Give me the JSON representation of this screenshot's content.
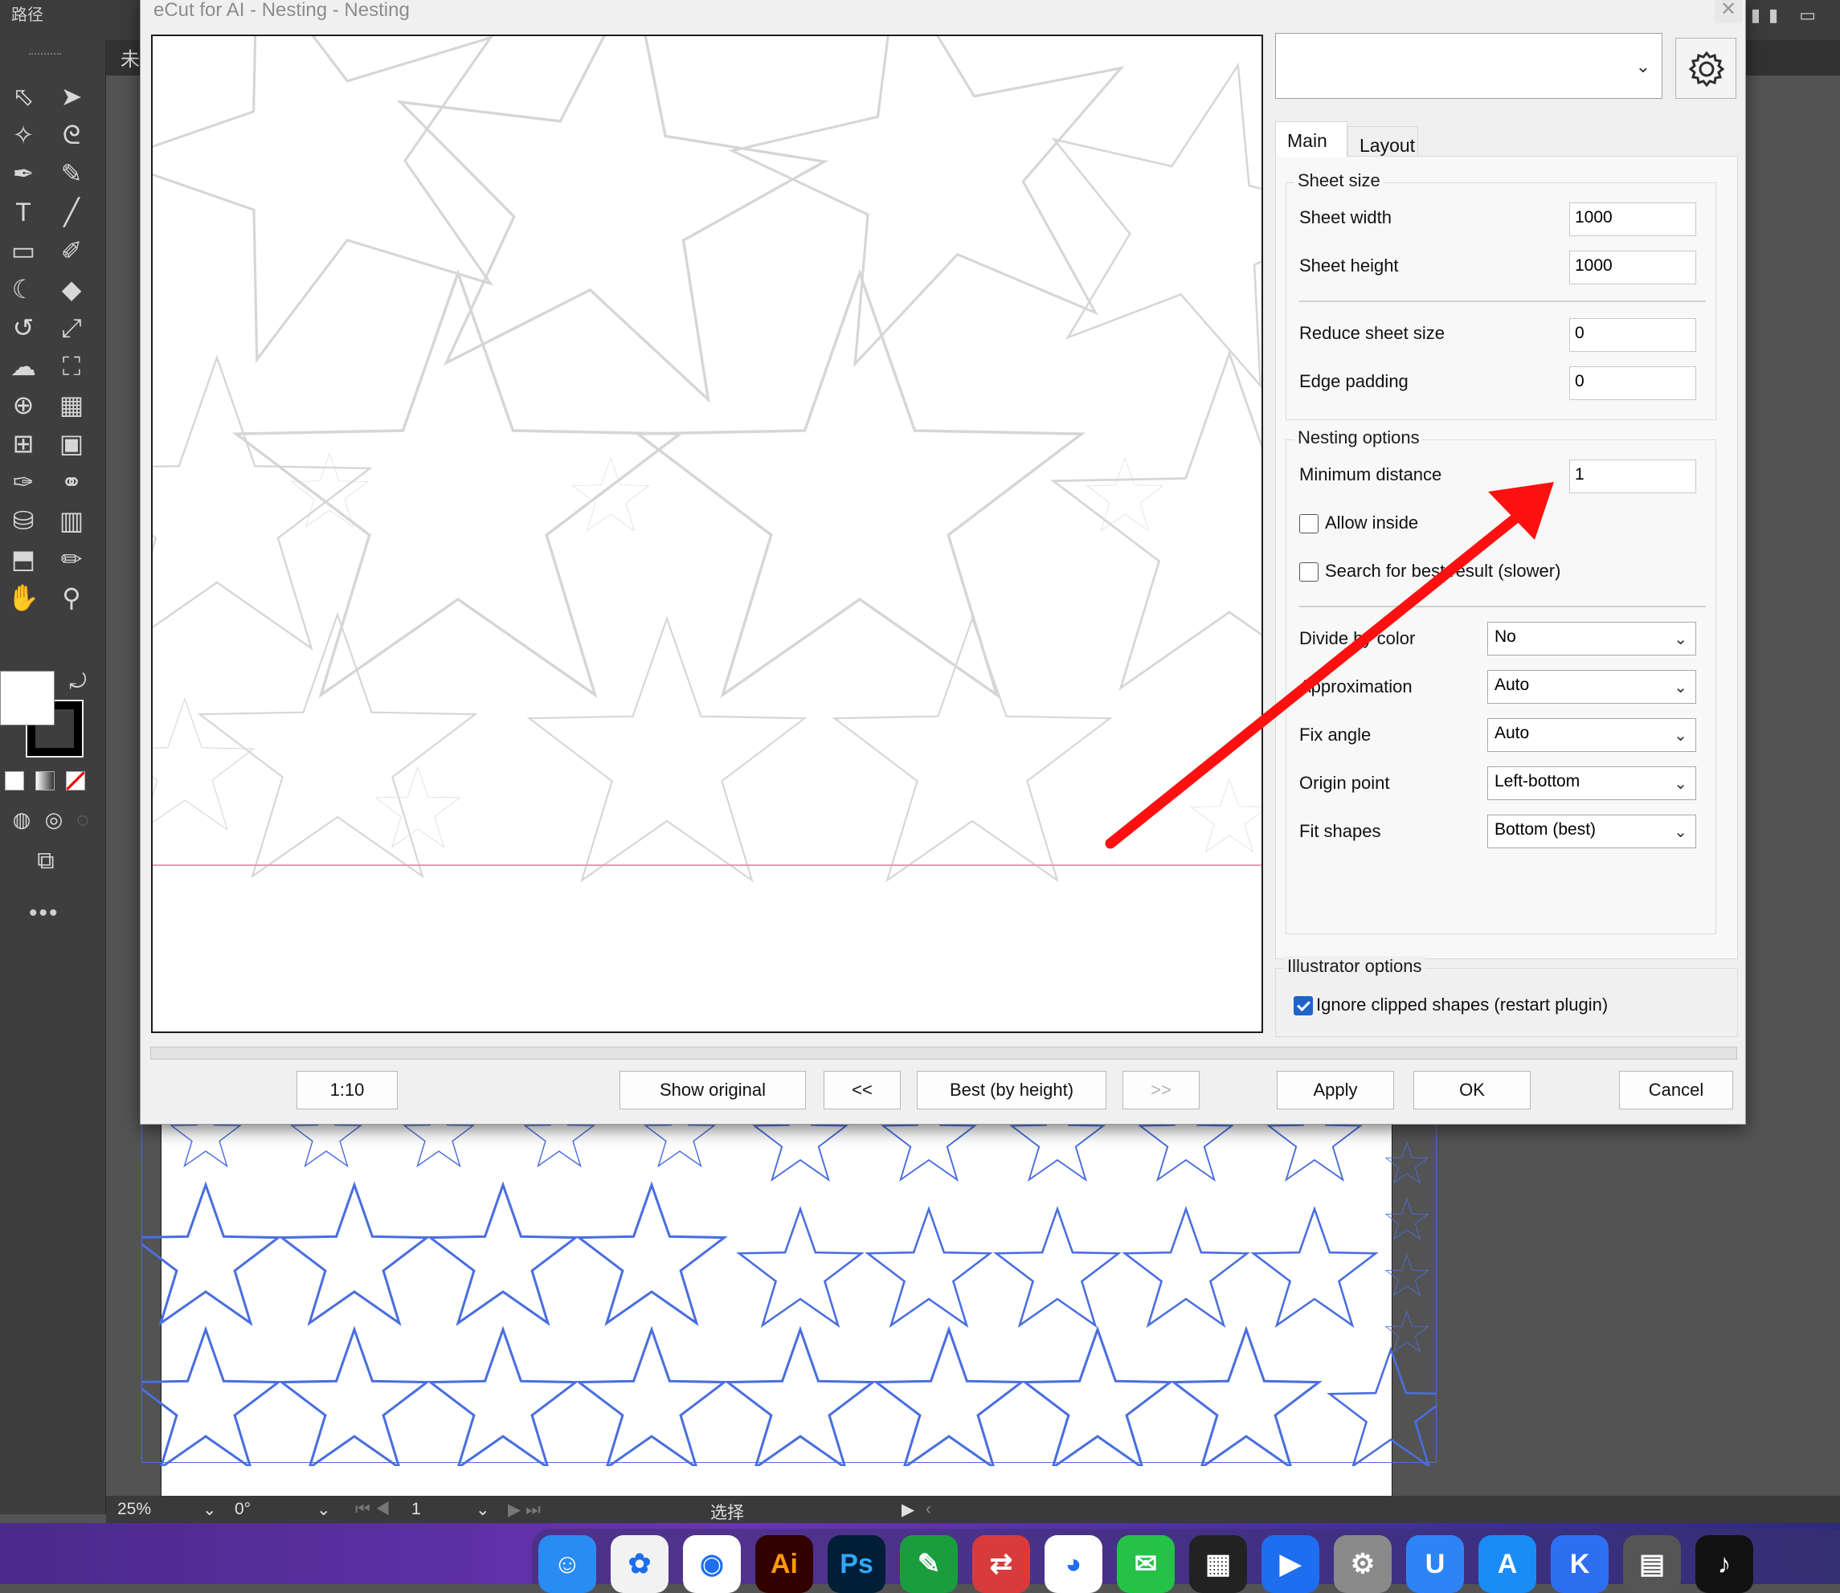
{
  "illustrator": {
    "topbar_title": "路径",
    "document_tab": "未",
    "status": {
      "zoom": "25%",
      "rotation": "0°",
      "artboard": "1",
      "tool_status": "选择"
    }
  },
  "dialog": {
    "title": "eCut for AI - Nesting - Nesting",
    "close": "✕",
    "preset_value": "",
    "tabs": [
      "Main",
      "Layout"
    ],
    "sheet_size": {
      "legend": "Sheet size",
      "sheet_width_label": "Sheet width",
      "sheet_width": "1000",
      "sheet_height_label": "Sheet height",
      "sheet_height": "1000",
      "reduce_label": "Reduce sheet size",
      "reduce": "0",
      "edge_label": "Edge padding",
      "edge": "0"
    },
    "nesting": {
      "legend": "Nesting options",
      "min_distance_label": "Minimum distance",
      "min_distance": "1",
      "allow_inside_label": "Allow inside",
      "search_best_label": "Search for best result (slower)",
      "divide_label": "Divide by color",
      "divide": "No",
      "approx_label": "Approximation",
      "approx": "Auto",
      "fix_angle_label": "Fix angle",
      "fix_angle": "Auto",
      "origin_label": "Origin point",
      "origin": "Left-bottom",
      "fit_label": "Fit shapes",
      "fit": "Bottom (best)"
    },
    "illustrator_options": {
      "legend": "Illustrator options",
      "ignore_clipped_label": "Ignore clipped shapes (restart plugin)",
      "ignore_clipped": true
    },
    "buttons": {
      "scale": "1:10",
      "show_original": "Show original",
      "prev": "<<",
      "best": "Best (by height)",
      "next": ">>",
      "apply": "Apply",
      "ok": "OK",
      "cancel": "Cancel"
    }
  },
  "dock": {
    "apps": [
      {
        "name": "Finder",
        "icon": "finder-icon",
        "color": "#2a8bf2",
        "glyph": "☺"
      },
      {
        "name": "Photos",
        "icon": "photos-icon",
        "color": "#f2f2f2",
        "glyph": "✿"
      },
      {
        "name": "Chrome",
        "icon": "chrome-icon",
        "color": "#ffffff",
        "glyph": "◉"
      },
      {
        "name": "Illustrator",
        "icon": "illustrator-icon",
        "color": "#330000",
        "glyph": "Ai"
      },
      {
        "name": "Photoshop",
        "icon": "photoshop-icon",
        "color": "#001e36",
        "glyph": "Ps"
      },
      {
        "name": "Marker",
        "icon": "marker-icon",
        "color": "#1a9e3c",
        "glyph": "✎"
      },
      {
        "name": "Remote",
        "icon": "remote-icon",
        "color": "#d83b3b",
        "glyph": "⇄"
      },
      {
        "name": "QQ",
        "icon": "qq-icon",
        "color": "#ffffff",
        "glyph": "◕"
      },
      {
        "name": "WeChat",
        "icon": "wechat-icon",
        "color": "#25c247",
        "glyph": "✉"
      },
      {
        "name": "Final Cut",
        "icon": "finalcut-icon",
        "color": "#222222",
        "glyph": "▦"
      },
      {
        "name": "Player",
        "icon": "player-icon",
        "color": "#1e6ef0",
        "glyph": "▶"
      },
      {
        "name": "Settings",
        "icon": "settings-icon",
        "color": "#8a8a8a",
        "glyph": "⚙"
      },
      {
        "name": "Tool",
        "icon": "tool-icon",
        "color": "#2d84f5",
        "glyph": "U"
      },
      {
        "name": "App Store",
        "icon": "appstore-icon",
        "color": "#1a8cf5",
        "glyph": "A"
      },
      {
        "name": "K App",
        "icon": "k-app-icon",
        "color": "#2e6ff2",
        "glyph": "K"
      },
      {
        "name": "Calculator",
        "icon": "calculator-icon",
        "color": "#555555",
        "glyph": "▤"
      },
      {
        "name": "TikTok",
        "icon": "tiktok-icon",
        "color": "#111111",
        "glyph": "♪"
      }
    ]
  }
}
